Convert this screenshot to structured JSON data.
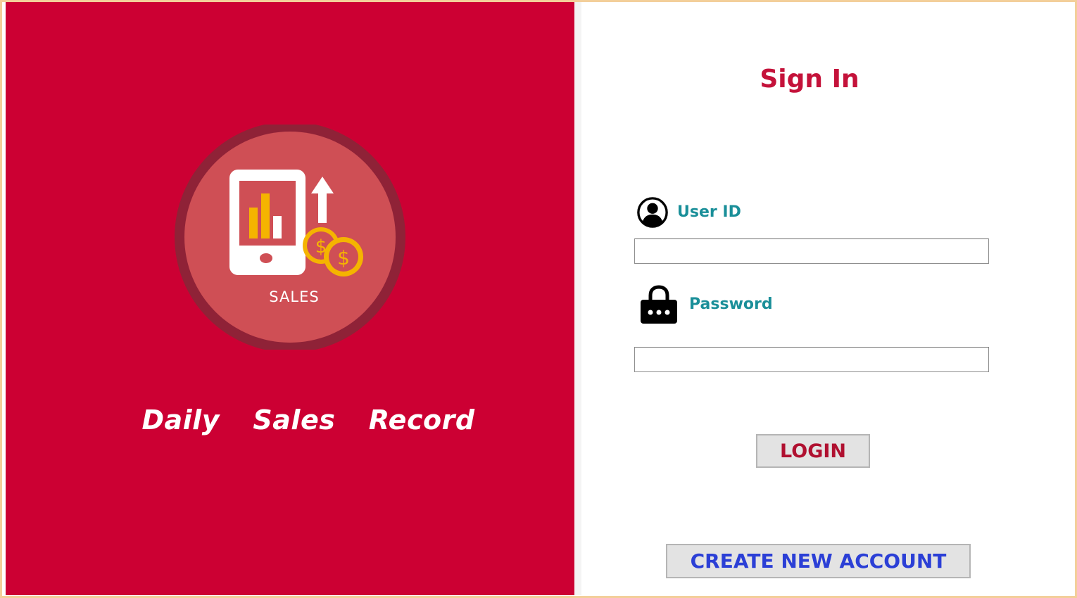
{
  "brand": {
    "logo_text": "SALES",
    "app_name": "Daily  Sales  Record"
  },
  "signin": {
    "title": "Sign In",
    "user_id_label": "User ID",
    "user_id_value": "",
    "password_label": "Password",
    "password_value": "",
    "login_label": "LOGIN",
    "create_account_label": "CREATE NEW ACCOUNT"
  },
  "icons": {
    "user": "user-circle-icon",
    "password": "lock-icon",
    "logo": "sales-phone-chart-icon"
  },
  "colors": {
    "brand_red": "#cc0033",
    "title_red": "#c4123a",
    "label_teal": "#1a8f99",
    "create_blue": "#2b3fd6",
    "window_border": "#f3cf9a"
  }
}
